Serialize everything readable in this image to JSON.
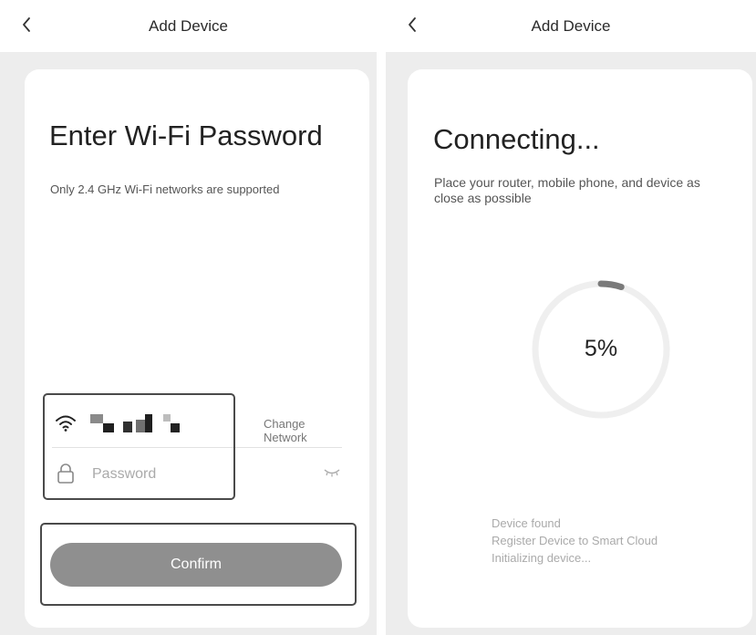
{
  "left_screen": {
    "header": {
      "title": "Add Device"
    },
    "title": "Enter Wi-Fi Password",
    "subtitle": "Only 2.4 GHz Wi-Fi networks are supported",
    "change_network_label": "Change Network",
    "password_placeholder": "Password",
    "confirm_label": "Confirm"
  },
  "right_screen": {
    "header": {
      "title": "Add Device"
    },
    "title": "Connecting...",
    "subtitle": "Place your router, mobile phone, and device as close as possible",
    "progress": {
      "value": 0.05,
      "label": "5%"
    },
    "status_lines": [
      "Device found",
      "Register Device to Smart Cloud",
      "Initializing device..."
    ]
  },
  "colors": {
    "page_background": "#ededed",
    "card_background": "#ffffff",
    "button_gray": "#8f8f8f",
    "highlight_border": "#4a4a4a",
    "progress_track": "#efefef",
    "progress_arc": "#7a7a7a"
  },
  "icons": {
    "back": "chevron-left-icon",
    "wifi": "wifi-icon",
    "lock": "lock-icon",
    "eye_closed": "eye-closed-icon"
  }
}
